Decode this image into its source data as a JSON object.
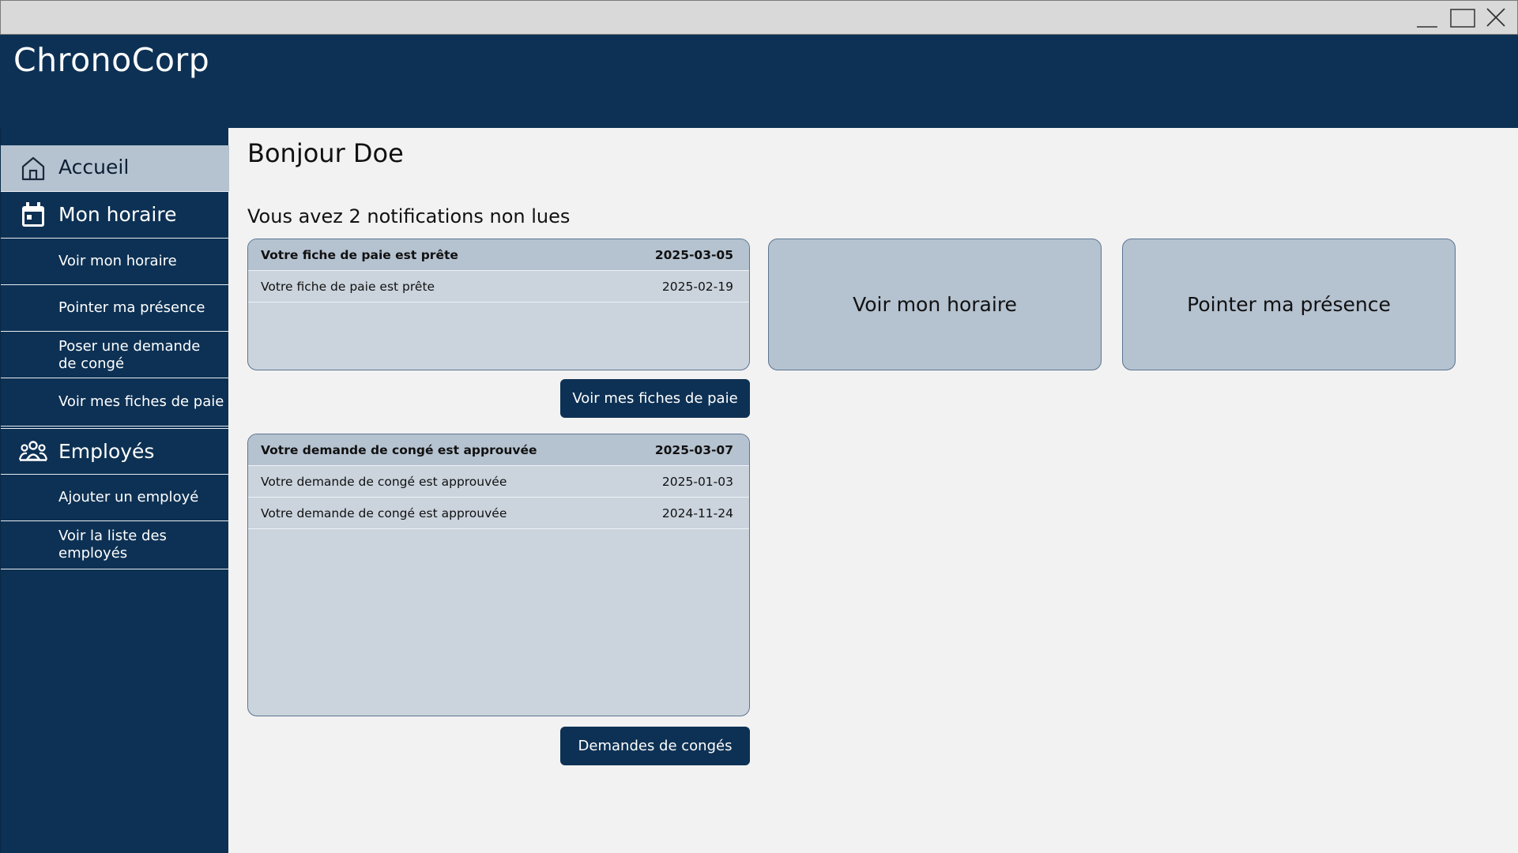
{
  "app": {
    "name": "ChronoCorp"
  },
  "sidebar": {
    "items": [
      {
        "label": "Accueil",
        "icon": "home-icon",
        "active": true
      },
      {
        "label": "Mon horaire",
        "icon": "calendar-icon"
      },
      {
        "label": "Voir mon horaire"
      },
      {
        "label": "Pointer ma présence"
      },
      {
        "label": "Poser une demande de congé"
      },
      {
        "label": "Voir mes fiches de paie"
      },
      {
        "label": "Employés",
        "icon": "people-icon"
      },
      {
        "label": "Ajouter un employé"
      },
      {
        "label": "Voir la liste des employés"
      }
    ]
  },
  "main": {
    "greeting": "Bonjour Doe",
    "notif_summary": "Vous avez 2 notifications non lues",
    "payslips": {
      "rows": [
        {
          "title": "Votre fiche de paie est prête",
          "date": "2025-03-05",
          "unread": true
        },
        {
          "title": "Votre fiche de paie est prête",
          "date": "2025-02-19"
        }
      ],
      "button": "Voir mes fiches de paie"
    },
    "leave": {
      "rows": [
        {
          "title": "Votre demande de congé est approuvée",
          "date": "2025-03-07",
          "unread": true
        },
        {
          "title": "Votre demande de congé est approuvée",
          "date": "2025-01-03"
        },
        {
          "title": "Votre demande de congé est approuvée",
          "date": "2024-11-24"
        }
      ],
      "button": "Demandes de congés"
    },
    "tiles": [
      {
        "label": "Voir mon horaire"
      },
      {
        "label": "Pointer ma présence"
      }
    ]
  },
  "colors": {
    "navy": "#0d3154",
    "accent_light": "#b5c2d0",
    "card": "#cbd4dd",
    "background": "#f2f2f2"
  }
}
